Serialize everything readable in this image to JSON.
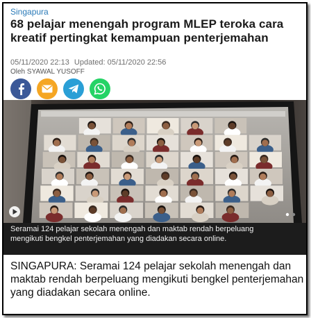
{
  "article": {
    "section": "Singapura",
    "headline": "68 pelajar menengah program MLEP teroka cara kreatif pertingkat kemampuan penterjemahan",
    "published": "05/11/2020 22:13",
    "updated": "Updated: 05/11/2020 22:56",
    "byline": "Oleh SYAWAL YUSOFF",
    "photo_caption": "Seramai 124 pelajar sekolah menengah dan maktab rendah berpeluang mengikuti bengkel penterjemahan yang diadakan secara online.",
    "lead": "SINGAPURA: Seramai 124 pelajar sekolah menengah dan maktab rendah berpeluang mengikuti bengkel penterjemahan yang diadakan secara online."
  },
  "share": {
    "buttons": [
      {
        "icon": "facebook-icon",
        "color": "#3b5998"
      },
      {
        "icon": "email-icon",
        "color": "#f5a623"
      },
      {
        "icon": "telegram-icon",
        "color": "#2a9fd6"
      },
      {
        "icon": "whatsapp-icon",
        "color": "#25d366"
      }
    ]
  },
  "colors": {
    "section": "#2a7ab8",
    "caption_bar": "#1c1c1c"
  }
}
